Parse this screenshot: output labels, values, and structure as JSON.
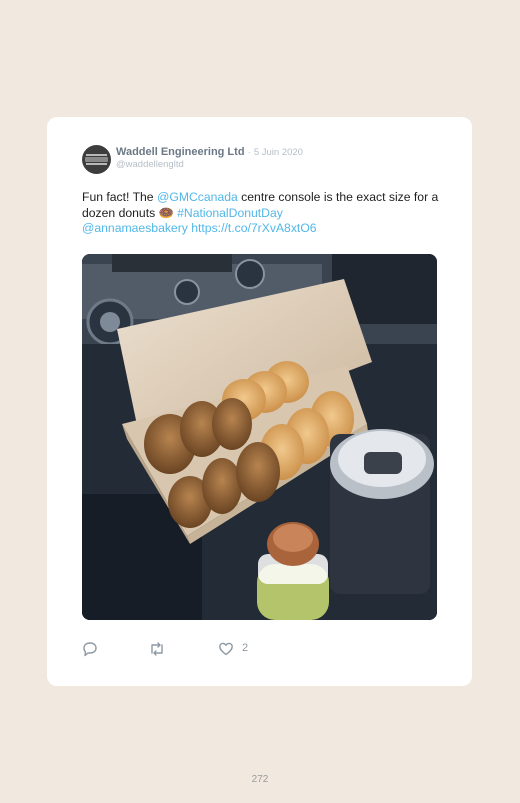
{
  "tweet": {
    "display_name": "Waddell Engineering Ltd",
    "separator": "·",
    "date": "5 Juin 2020",
    "handle": "@waddellengltd",
    "text_part1": "Fun fact! The ",
    "mention1": "@GMCcanada",
    "text_part2": " centre console is the exact size for a dozen donuts ",
    "emoji": "🍩",
    "hashtag": " #NationalDonutDay",
    "mention2": "@annamaesbakery",
    "link": " https://t.co/7rXvA8xtO6",
    "like_count": "2"
  },
  "icons": {
    "reply": "reply-icon",
    "retweet": "retweet-icon",
    "like": "heart-icon"
  },
  "colors": {
    "background": "#f1e8e0",
    "link": "#52b7e8",
    "display_name": "#6b7885"
  },
  "page": {
    "number": "272"
  }
}
